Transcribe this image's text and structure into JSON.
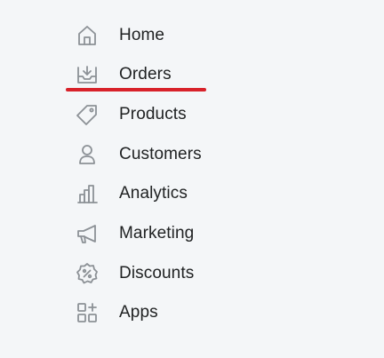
{
  "nav": {
    "items": [
      {
        "label": "Home",
        "icon": "home-icon"
      },
      {
        "label": "Orders",
        "icon": "orders-icon",
        "active": true
      },
      {
        "label": "Products",
        "icon": "tag-icon"
      },
      {
        "label": "Customers",
        "icon": "person-icon"
      },
      {
        "label": "Analytics",
        "icon": "bar-chart-icon"
      },
      {
        "label": "Marketing",
        "icon": "megaphone-icon"
      },
      {
        "label": "Discounts",
        "icon": "discount-icon"
      },
      {
        "label": "Apps",
        "icon": "apps-icon"
      }
    ]
  },
  "colors": {
    "background": "#f4f6f8",
    "text": "#202223",
    "icon": "#8c9196",
    "active_underline": "#d8222a"
  }
}
